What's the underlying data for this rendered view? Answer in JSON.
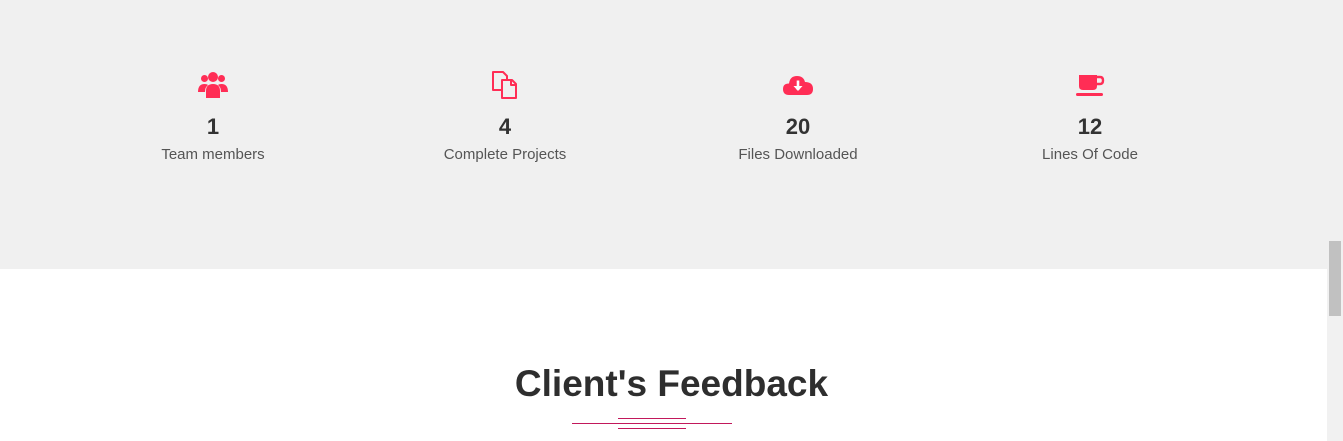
{
  "colors": {
    "accent": "#ff2d55",
    "stats_background": "#f0f0f0",
    "divider": "#c2185b"
  },
  "stats": [
    {
      "icon": "users-icon",
      "value": "1",
      "label": "Team members"
    },
    {
      "icon": "files-icon",
      "value": "4",
      "label": "Complete Projects"
    },
    {
      "icon": "cloud-download-icon",
      "value": "20",
      "label": "Files Downloaded"
    },
    {
      "icon": "coffee-cup-icon",
      "value": "12",
      "label": "Lines Of Code"
    }
  ],
  "feedback": {
    "title": "Client's Feedback"
  }
}
